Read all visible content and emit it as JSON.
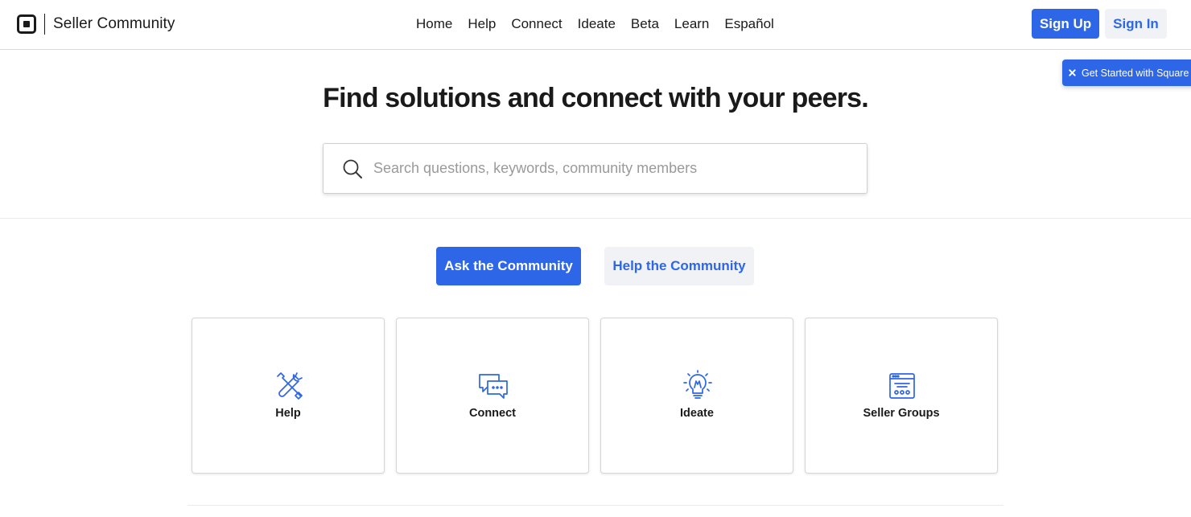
{
  "header": {
    "brand_name": "Seller Community",
    "nav": [
      {
        "label": "Home"
      },
      {
        "label": "Help"
      },
      {
        "label": "Connect"
      },
      {
        "label": "Ideate"
      },
      {
        "label": "Beta"
      },
      {
        "label": "Learn"
      },
      {
        "label": "Español"
      }
    ],
    "sign_up_label": "Sign Up",
    "sign_in_label": "Sign In"
  },
  "promo": {
    "label": "Get Started with Square"
  },
  "hero": {
    "title": "Find solutions and connect with your peers.",
    "search_placeholder": "Search questions, keywords, community members",
    "search_value": ""
  },
  "actions": {
    "ask_label": "Ask the Community",
    "help_label": "Help the Community"
  },
  "cards": [
    {
      "label": "Help",
      "icon": "tools-icon"
    },
    {
      "label": "Connect",
      "icon": "chat-bubbles-icon"
    },
    {
      "label": "Ideate",
      "icon": "lightbulb-icon"
    },
    {
      "label": "Seller Groups",
      "icon": "groups-window-icon"
    }
  ],
  "colors": {
    "accent": "#2e66e8",
    "secondary_button_bg": "#f0f2f5",
    "text": "#1a1a1a",
    "placeholder": "#9a9a9a"
  }
}
